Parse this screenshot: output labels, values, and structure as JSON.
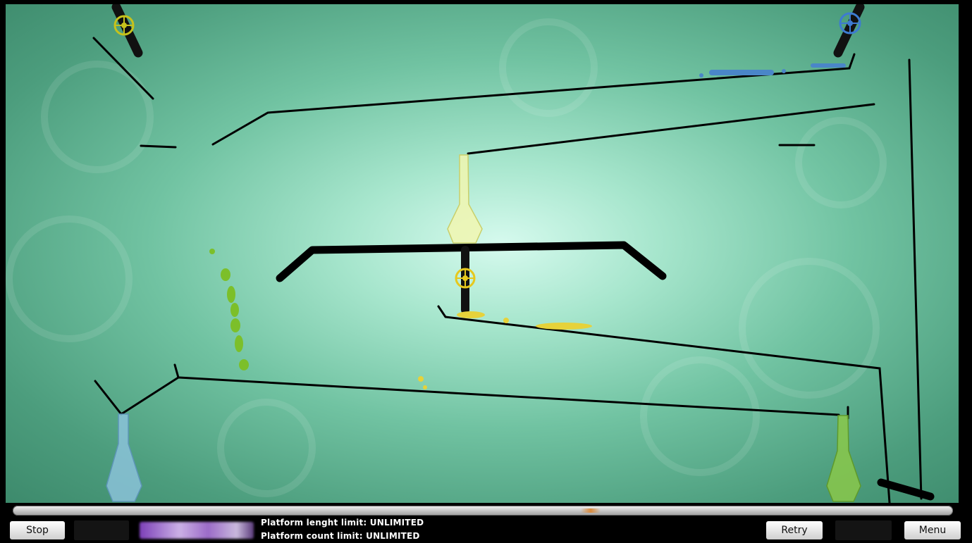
{
  "game": {
    "colors": {
      "background_light": "#d6faee",
      "background_dark": "#3d8a6c",
      "line": "#000000",
      "green_liquid": "#7cbf2a",
      "yellow_liquid": "#e6d23a",
      "blue_liquid": "#4a86c8",
      "vase_yellow": "#f1f6b0",
      "vase_blue": "#8fc4df",
      "vase_green": "#8ac84a"
    },
    "emitters": [
      {
        "id": "green",
        "icon": "valve-wheel-icon",
        "color": "#c6c21c"
      },
      {
        "id": "blue",
        "icon": "valve-wheel-icon",
        "color": "#3d7bd1"
      },
      {
        "id": "yellow",
        "icon": "valve-wheel-icon",
        "color": "#e6c81e"
      }
    ],
    "vases": [
      "vase-yellow",
      "vase-blue",
      "vase-green"
    ]
  },
  "hud": {
    "stop_label": "Stop",
    "retry_label": "Retry",
    "menu_label": "Menu",
    "platform_length_limit": "Platform lenght limit: UNLIMITED",
    "platform_count_limit": "Platform count limit: UNLIMITED"
  }
}
